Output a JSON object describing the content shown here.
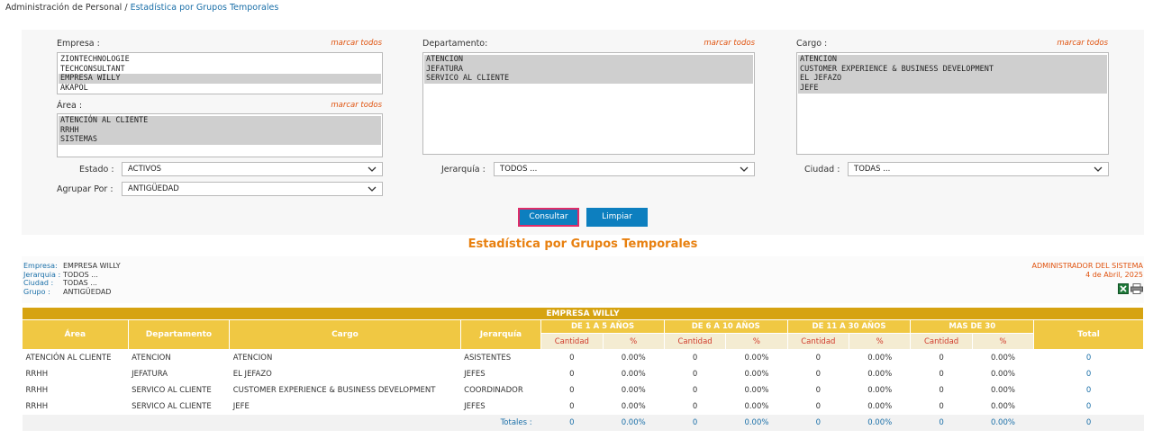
{
  "breadcrumb": {
    "parent": "Administración de Personal",
    "separator": " / ",
    "current": "Estadística por Grupos Temporales"
  },
  "filters": {
    "empresa": {
      "label": "Empresa :",
      "mark": "marcar todos",
      "options": [
        "ZIONTECHNOLOGIE",
        "TECHCONSULTANT",
        "EMPRESA WILLY",
        "AKAPOL"
      ],
      "selected": [
        "EMPRESA WILLY"
      ]
    },
    "area": {
      "label": "Área :",
      "mark": "marcar todos",
      "options": [
        "ATENCIÓN AL CLIENTE",
        "RRHH",
        "SISTEMAS"
      ],
      "selected": [
        "ATENCIÓN AL CLIENTE",
        "RRHH",
        "SISTEMAS"
      ]
    },
    "departamento": {
      "label": "Departamento:",
      "mark": "marcar todos",
      "options": [
        "ATENCION",
        "JEFATURA",
        "SERVICO AL CLIENTE"
      ],
      "selected": [
        "ATENCION",
        "JEFATURA",
        "SERVICO AL CLIENTE"
      ]
    },
    "cargo": {
      "label": "Cargo :",
      "mark": "marcar todos",
      "options": [
        "ATENCION",
        "CUSTOMER EXPERIENCE & BUSINESS DEVELOPMENT",
        "EL JEFAZO",
        "JEFE"
      ],
      "selected": [
        "ATENCION",
        "CUSTOMER EXPERIENCE & BUSINESS DEVELOPMENT",
        "EL JEFAZO",
        "JEFE"
      ]
    },
    "estado": {
      "label": "Estado :",
      "value": "ACTIVOS"
    },
    "agrupar": {
      "label": "Agrupar Por :",
      "value": "ANTIGÜEDAD"
    },
    "jerarquia": {
      "label": "Jerarquía :",
      "value": "TODOS ..."
    },
    "ciudad": {
      "label": "Ciudad :",
      "value": "TODAS ..."
    }
  },
  "buttons": {
    "consultar": "Consultar",
    "limpiar": "Limpiar"
  },
  "report": {
    "title": "Estadística por Grupos Temporales",
    "info": [
      {
        "key": "Empresa:",
        "value": "EMPRESA WILLY"
      },
      {
        "key": "Jerarquia :",
        "value": "TODOS ..."
      },
      {
        "key": "Ciudad :",
        "value": "TODAS ..."
      },
      {
        "key": "Grupo :",
        "value": "ANTIGÜEDAD"
      }
    ],
    "admin": "ADMINISTRADOR DEL SISTEMA",
    "date": "4 de Abril, 2025",
    "icons": [
      "excel-icon",
      "print-icon"
    ]
  },
  "table": {
    "group_title": "EMPRESA WILLY",
    "columns": {
      "area": "Área",
      "departamento": "Departamento",
      "cargo": "Cargo",
      "jerarquia": "Jerarquía",
      "total": "Total"
    },
    "ranges": [
      "DE 1 A 5 AÑOS",
      "DE 6 A 10 AÑOS",
      "DE 11 A 30 AÑOS",
      "MAS DE 30"
    ],
    "sub_cantidad": "Cantidad",
    "sub_pct": "%",
    "rows": [
      {
        "area": "ATENCIÓN AL CLIENTE",
        "departamento": "ATENCION",
        "cargo": "ATENCION",
        "jerarquia": "ASISTENTES",
        "values": [
          "0",
          "0.00%",
          "0",
          "0.00%",
          "0",
          "0.00%",
          "0",
          "0.00%"
        ],
        "total": "0"
      },
      {
        "area": "RRHH",
        "departamento": "JEFATURA",
        "cargo": "EL JEFAZO",
        "jerarquia": "JEFES",
        "values": [
          "0",
          "0.00%",
          "0",
          "0.00%",
          "0",
          "0.00%",
          "0",
          "0.00%"
        ],
        "total": "0"
      },
      {
        "area": "RRHH",
        "departamento": "SERVICO AL CLIENTE",
        "cargo": "CUSTOMER EXPERIENCE & BUSINESS DEVELOPMENT",
        "jerarquia": "COORDINADOR",
        "values": [
          "0",
          "0.00%",
          "0",
          "0.00%",
          "0",
          "0.00%",
          "0",
          "0.00%"
        ],
        "total": "0"
      },
      {
        "area": "RRHH",
        "departamento": "SERVICO AL CLIENTE",
        "cargo": "JEFE",
        "jerarquia": "JEFES",
        "values": [
          "0",
          "0.00%",
          "0",
          "0.00%",
          "0",
          "0.00%",
          "0",
          "0.00%"
        ],
        "total": "0"
      }
    ],
    "totals": {
      "label": "Totales :",
      "values": [
        "0",
        "0.00%",
        "0",
        "0.00%",
        "0",
        "0.00%",
        "0",
        "0.00%"
      ],
      "total": "0"
    }
  },
  "colors": {
    "accent_orange": "#e8800f",
    "link_blue": "#1a6fa8",
    "header_gold": "#f0c843",
    "group_gold": "#d6a311",
    "button_blue": "#0d7fbf"
  }
}
